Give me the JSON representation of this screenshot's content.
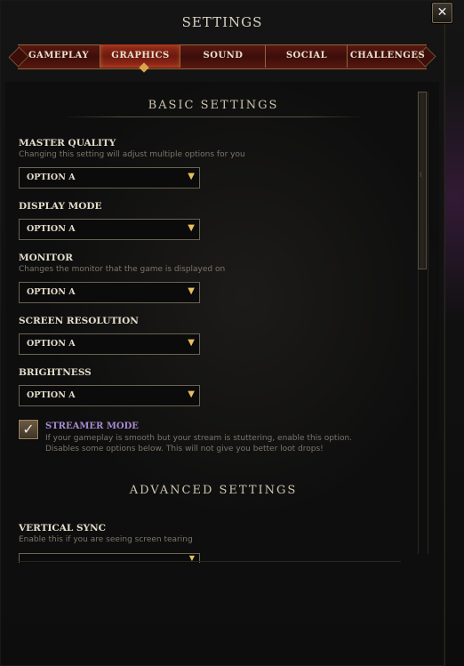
{
  "window": {
    "title": "SETTINGS",
    "close_label": "✕"
  },
  "tabs": [
    {
      "label": "GAMEPLAY",
      "active": false
    },
    {
      "label": "GRAPHICS",
      "active": true
    },
    {
      "label": "SOUND",
      "active": false
    },
    {
      "label": "SOCIAL",
      "active": false
    },
    {
      "label": "CHALLENGES",
      "active": false
    }
  ],
  "basic": {
    "title": "BASIC SETTINGS",
    "master_quality": {
      "label": "MASTER QUALITY",
      "desc": "Changing this setting will adjust multiple options for you",
      "value": "OPTION A"
    },
    "display_mode": {
      "label": "DISPLAY MODE",
      "value": "OPTION A"
    },
    "monitor": {
      "label": "MONITOR",
      "desc": "Changes the monitor that the game is displayed on",
      "value": "OPTION A"
    },
    "screen_resolution": {
      "label": "SCREEN RESOLUTION",
      "value": "OPTION A"
    },
    "brightness": {
      "label": "BRIGHTNESS",
      "value": "OPTION A"
    },
    "streamer_mode": {
      "label": "STREAMER MODE",
      "checked": true,
      "desc_line1": "If your gameplay is smooth but your stream is stuttering, enable this option.",
      "desc_line2": "Disables some options below. This will not give you better loot drops!"
    }
  },
  "advanced": {
    "title": "ADVANCED SETTINGS",
    "vertical_sync": {
      "label": "VERTICAL SYNC",
      "desc": "Enable this if you are seeing screen tearing"
    }
  },
  "icons": {
    "dropdown_arrow": "▼",
    "checkmark": "✓",
    "scroll_grip": "⁝"
  },
  "colors": {
    "accent_gold": "#e8c060",
    "tab_active": "#9a2b1a",
    "streamer_purple": "#a88bd0"
  }
}
